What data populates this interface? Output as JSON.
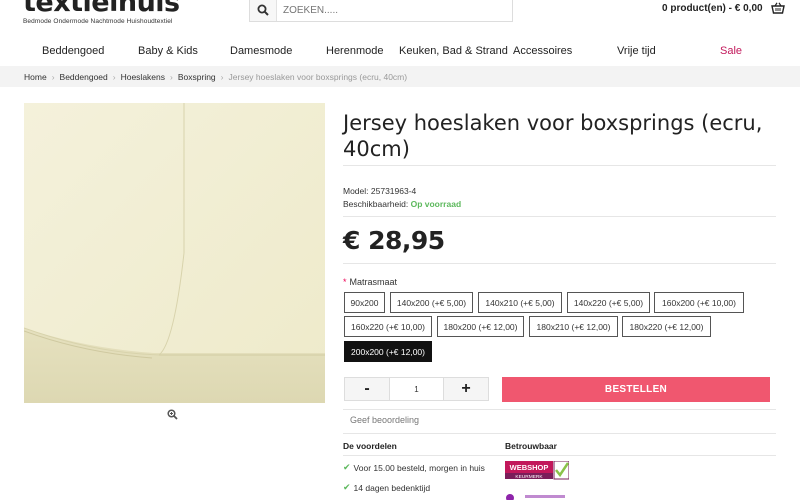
{
  "brand": {
    "name": "textielhuis",
    "tagline": "Bedmode  Ondermode  Nachtmode  Huishoudtextiel"
  },
  "search": {
    "placeholder": "ZOEKEN....."
  },
  "cart": {
    "label": "0 product(en) - € 0,00"
  },
  "nav": {
    "items": [
      {
        "label": "Beddengoed"
      },
      {
        "label": "Baby & Kids"
      },
      {
        "label": "Damesmode"
      },
      {
        "label": "Herenmode"
      },
      {
        "label": "Keuken, Bad & Strand"
      },
      {
        "label": "Accessoires"
      },
      {
        "label": "Vrije tijd"
      },
      {
        "label": "Sale"
      }
    ]
  },
  "breadcrumb": {
    "items": [
      "Home",
      "Beddengoed",
      "Hoeslakens",
      "Boxspring",
      "Jersey hoeslaken voor boxsprings (ecru, 40cm)"
    ]
  },
  "product": {
    "title": "Jersey hoeslaken voor boxsprings (ecru, 40cm)",
    "model_label": "Model:",
    "model": "25731963-4",
    "availability_label": "Beschikbaarheid:",
    "availability": "Op voorraad",
    "price": "€ 28,95"
  },
  "options": {
    "required_mark": "*",
    "label": "Matrasmaat",
    "values": [
      "90x200",
      "140x200 (+€ 5,00)",
      "140x210 (+€ 5,00)",
      "140x220 (+€ 5,00)",
      "160x200 (+€ 10,00)",
      "160x220 (+€ 10,00)",
      "180x200 (+€ 12,00)",
      "180x210 (+€ 12,00)",
      "180x220 (+€ 12,00)",
      "200x200 (+€ 12,00)"
    ],
    "selected": "200x200 (+€ 12,00)"
  },
  "quantity": {
    "minus": "-",
    "value": "1",
    "plus": "+"
  },
  "buy_button": "BESTELLEN",
  "review_link": "Geef beoordeling",
  "benefits": {
    "heading": "De voordelen",
    "items": [
      "Voor 15.00 besteld, morgen in huis",
      "14 dagen bedenktijd"
    ]
  },
  "trust": {
    "heading": "Betrouwbaar",
    "badge_text": "WEBSHOP",
    "badge_sub": "KEURMERK"
  },
  "colors": {
    "accent_pink": "#f0576f",
    "sale": "#c2185b",
    "in_stock": "#5cb85c",
    "selected_option": "#111111"
  }
}
